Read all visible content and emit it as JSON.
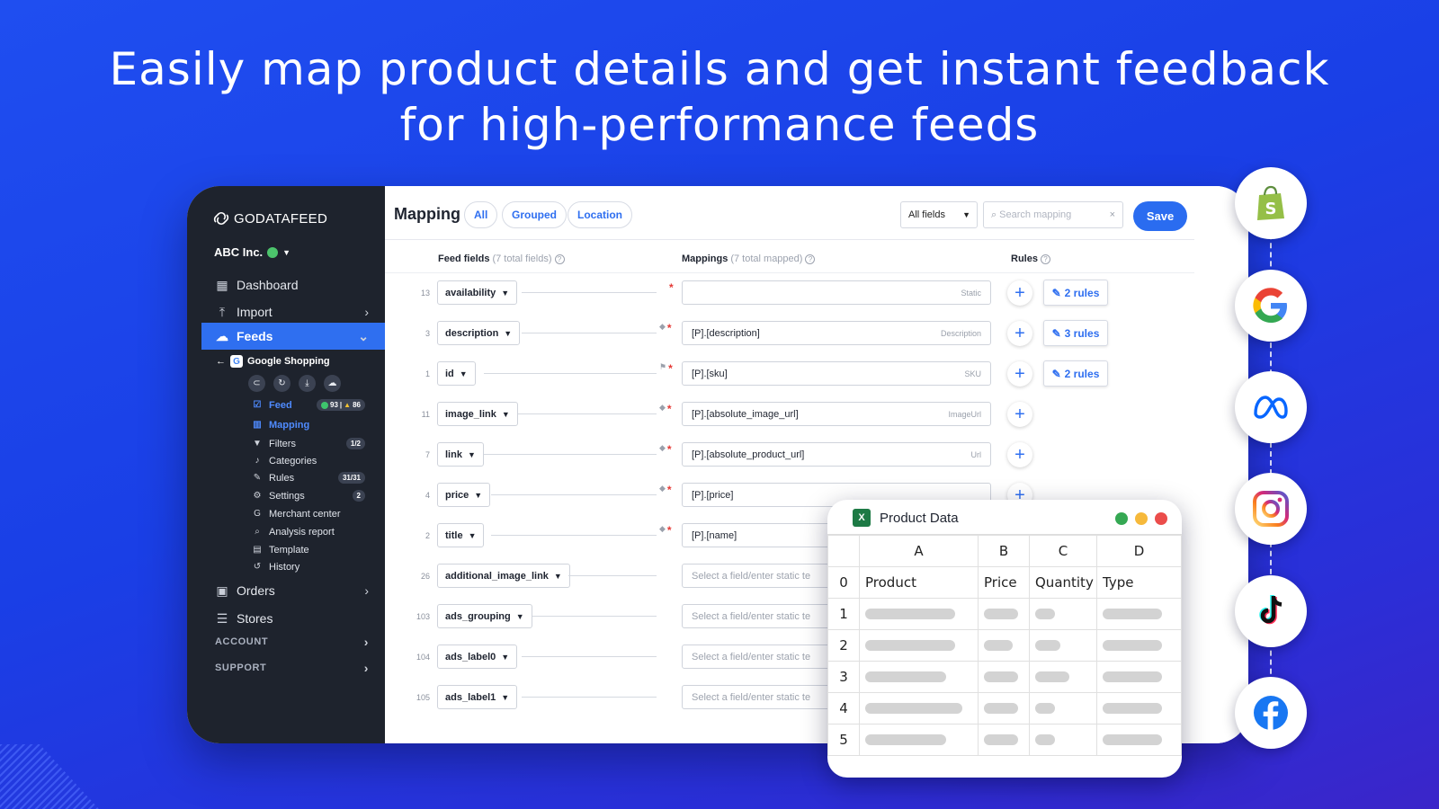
{
  "headline": {
    "line1": "Easily map product details and get instant feedback",
    "line2": "for high-performance feeds"
  },
  "sidebar": {
    "logo": "GODATAFEED",
    "org": "ABC Inc.",
    "items": [
      {
        "label": "Dashboard",
        "icon": "grid-icon"
      },
      {
        "label": "Import",
        "icon": "upload-icon"
      },
      {
        "label": "Feeds",
        "icon": "cloud-icon"
      }
    ],
    "feed_name": "Google Shopping",
    "subnav": {
      "feed": "Feed",
      "feed_ok": "93",
      "feed_warn": "86",
      "mapping": "Mapping",
      "filters": "Filters",
      "filters_badge": "1/2",
      "categories": "Categories",
      "rules": "Rules",
      "rules_badge": "31/31",
      "settings": "Settings",
      "settings_badge": "2",
      "merchant": "Merchant center",
      "analysis": "Analysis report",
      "template": "Template",
      "history": "History"
    },
    "orders": "Orders",
    "stores": "Stores",
    "account": "ACCOUNT",
    "support": "SUPPORT"
  },
  "topbar": {
    "title": "Mapping",
    "tabs": [
      "All",
      "Grouped",
      "Location"
    ],
    "filter_value": "All fields",
    "search_placeholder": "Search mapping",
    "save": "Save"
  },
  "columns": {
    "feed_fields": "Feed fields",
    "feed_fields_sub": "(7 total fields)",
    "mappings": "Mappings",
    "mappings_sub": "(7 total mapped)",
    "rules": "Rules"
  },
  "rows": [
    {
      "num": "13",
      "field": "availability",
      "value": "",
      "tag": "Static",
      "rules": "2 rules"
    },
    {
      "num": "3",
      "field": "description",
      "value": "[P].[description]",
      "tag": "Description",
      "rules": "3 rules"
    },
    {
      "num": "1",
      "field": "id",
      "value": "[P].[sku]",
      "tag": "SKU",
      "rules": "2 rules"
    },
    {
      "num": "11",
      "field": "image_link",
      "value": "[P].[absolute_image_url]",
      "tag": "ImageUrl",
      "rules": ""
    },
    {
      "num": "7",
      "field": "link",
      "value": "[P].[absolute_product_url]",
      "tag": "Url",
      "rules": ""
    },
    {
      "num": "4",
      "field": "price",
      "value": "[P].[price]",
      "tag": "",
      "rules": ""
    },
    {
      "num": "2",
      "field": "title",
      "value": "[P].[name]",
      "tag": "",
      "rules": ""
    },
    {
      "num": "26",
      "field": "additional_image_link",
      "value": "Select a field/enter static te",
      "tag": "",
      "rules": ""
    },
    {
      "num": "103",
      "field": "ads_grouping",
      "value": "Select a field/enter static te",
      "tag": "",
      "rules": ""
    },
    {
      "num": "104",
      "field": "ads_label0",
      "value": "Select a field/enter static te",
      "tag": "",
      "rules": ""
    },
    {
      "num": "105",
      "field": "ads_label1",
      "value": "Select a field/enter static te",
      "tag": "",
      "rules": ""
    }
  ],
  "product_data": {
    "title": "Product Data",
    "col_letters": [
      "A",
      "B",
      "C",
      "D"
    ],
    "headers": [
      "Product",
      "Price",
      "Quantity",
      "Type"
    ],
    "row_numbers": [
      "0",
      "1",
      "2",
      "3",
      "4",
      "5"
    ]
  },
  "brands": [
    "shopify-icon",
    "google-icon",
    "meta-icon",
    "instagram-icon",
    "tiktok-icon",
    "facebook-icon"
  ],
  "colors": {
    "accent": "#2f6ff0",
    "sidebar": "#1e232d",
    "background": "#1f4ef0"
  }
}
